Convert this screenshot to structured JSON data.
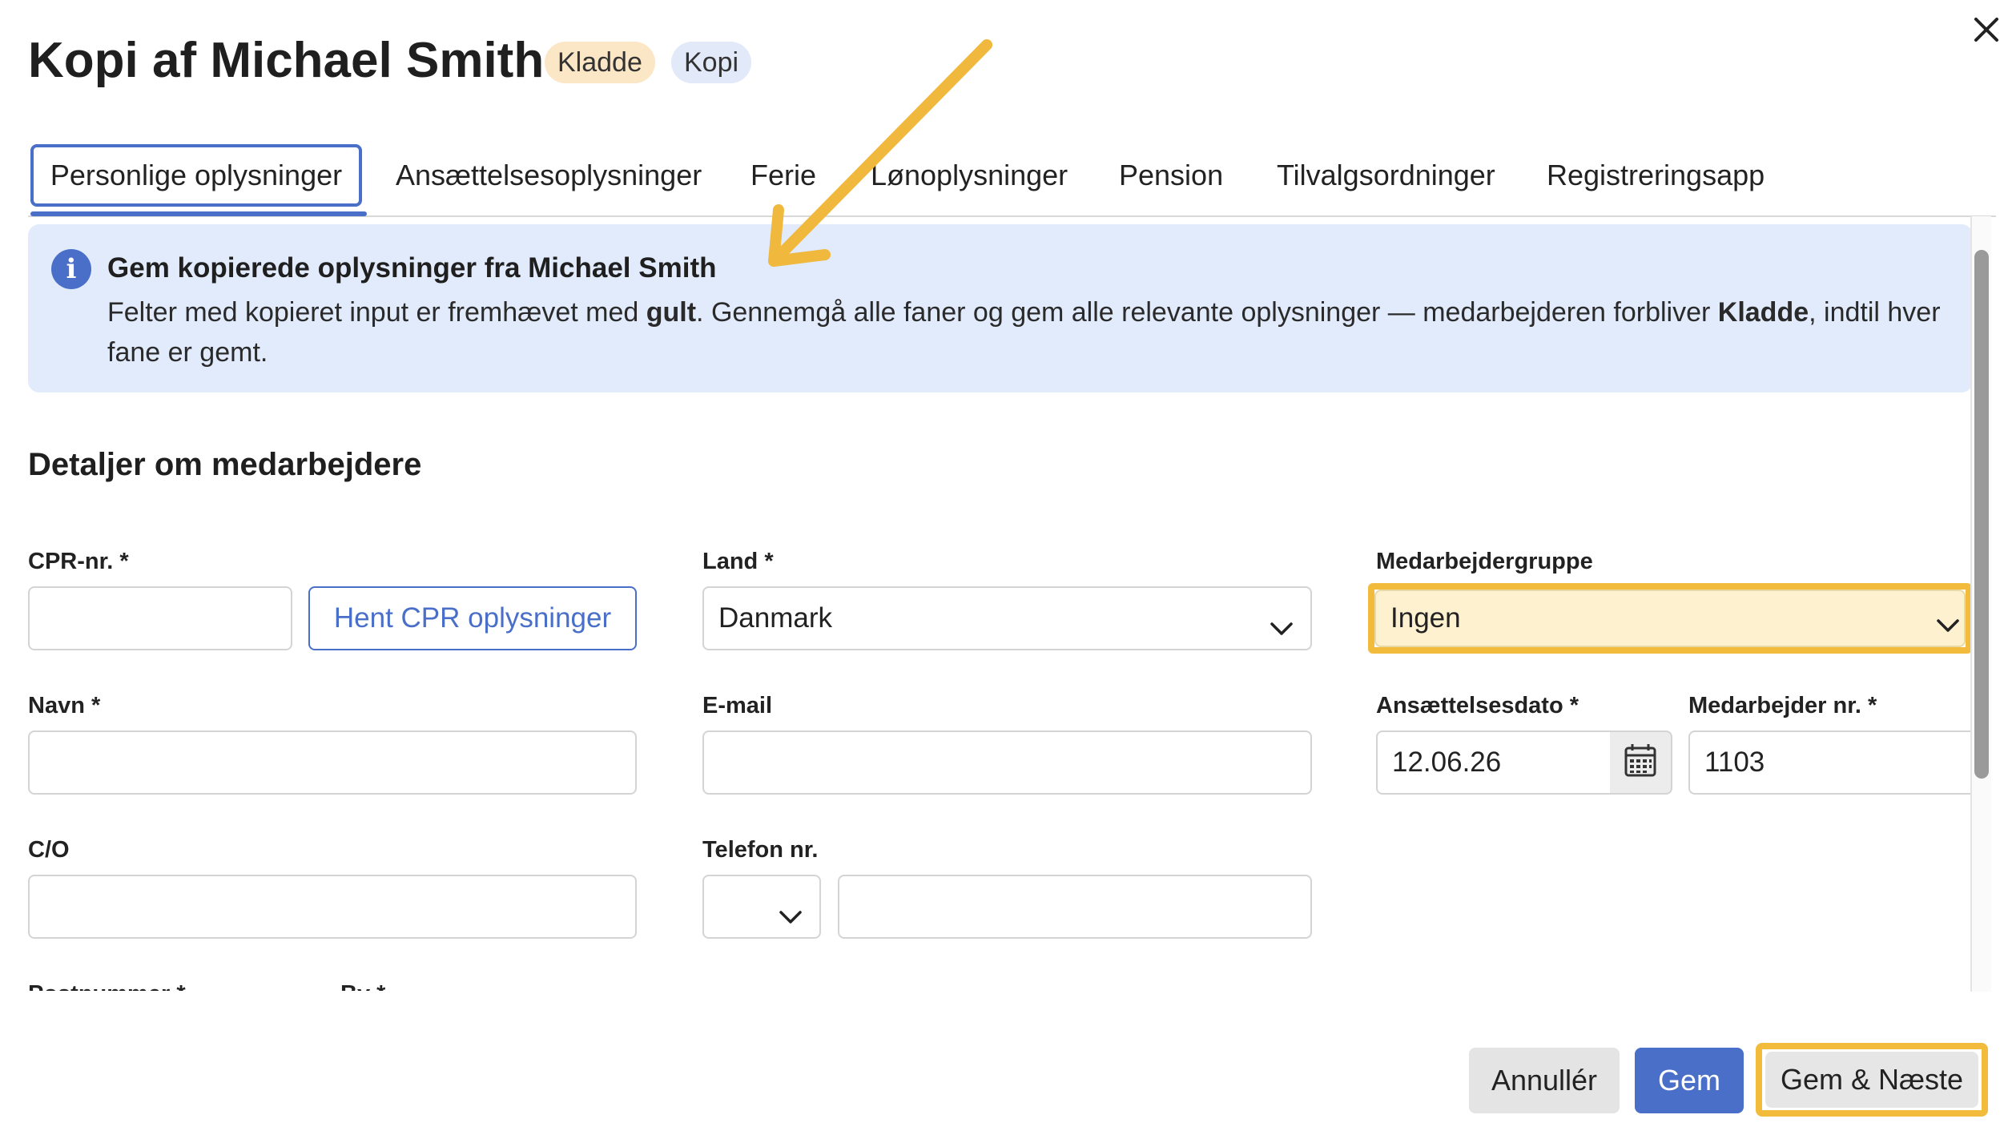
{
  "header": {
    "title": "Kopi af Michael Smith",
    "badges": [
      "Kladde",
      "Kopi"
    ]
  },
  "tabs": [
    {
      "label": "Personlige oplysninger",
      "active": true
    },
    {
      "label": "Ansættelsesoplysninger",
      "active": false
    },
    {
      "label": "Ferie",
      "active": false
    },
    {
      "label": "Lønoplysninger",
      "active": false
    },
    {
      "label": "Pension",
      "active": false
    },
    {
      "label": "Tilvalgsordninger",
      "active": false
    },
    {
      "label": "Registreringsapp",
      "active": false
    }
  ],
  "banner": {
    "title": "Gem kopierede oplysninger fra Michael Smith",
    "text_1": "Felter med kopieret input er fremhævet med ",
    "text_bold_1": "gult",
    "text_2": ". Gennemgå alle faner og gem alle relevante oplysninger — medarbejderen forbliver ",
    "text_bold_2": "Kladde",
    "text_3": ", indtil hver fane er gemt."
  },
  "section": {
    "title": "Detaljer om medarbejdere"
  },
  "fields": {
    "cpr": {
      "label": "CPR-nr. *",
      "value": ""
    },
    "cpr_button": "Hent CPR oplysninger",
    "land": {
      "label": "Land *",
      "value": "Danmark"
    },
    "medarbejdergruppe": {
      "label": "Medarbejdergruppe",
      "value": "Ingen"
    },
    "navn": {
      "label": "Navn *",
      "value": ""
    },
    "email": {
      "label": "E-mail",
      "value": ""
    },
    "ansaettelsesdato": {
      "label": "Ansættelsesdato *",
      "value": "12.06.26"
    },
    "medarbejder_nr": {
      "label": "Medarbejder nr. *",
      "value": "1103"
    },
    "co": {
      "label": "C/O",
      "value": ""
    },
    "telefon": {
      "label": "Telefon nr.",
      "prefix": "",
      "value": ""
    },
    "postnummer": {
      "label": "Postnummer *"
    },
    "by": {
      "label": "By *"
    }
  },
  "footer": {
    "cancel": "Annullér",
    "save": "Gem",
    "save_next": "Gem & Næste"
  },
  "colors": {
    "accent": "#4a6fc9",
    "highlight": "#f2bb3c",
    "highlight_fill": "#fdf1cf",
    "banner_bg": "#e1ebfc"
  },
  "icons": [
    "close-icon",
    "info-icon",
    "chevron-down-icon",
    "calendar-icon",
    "annotation-arrow"
  ]
}
